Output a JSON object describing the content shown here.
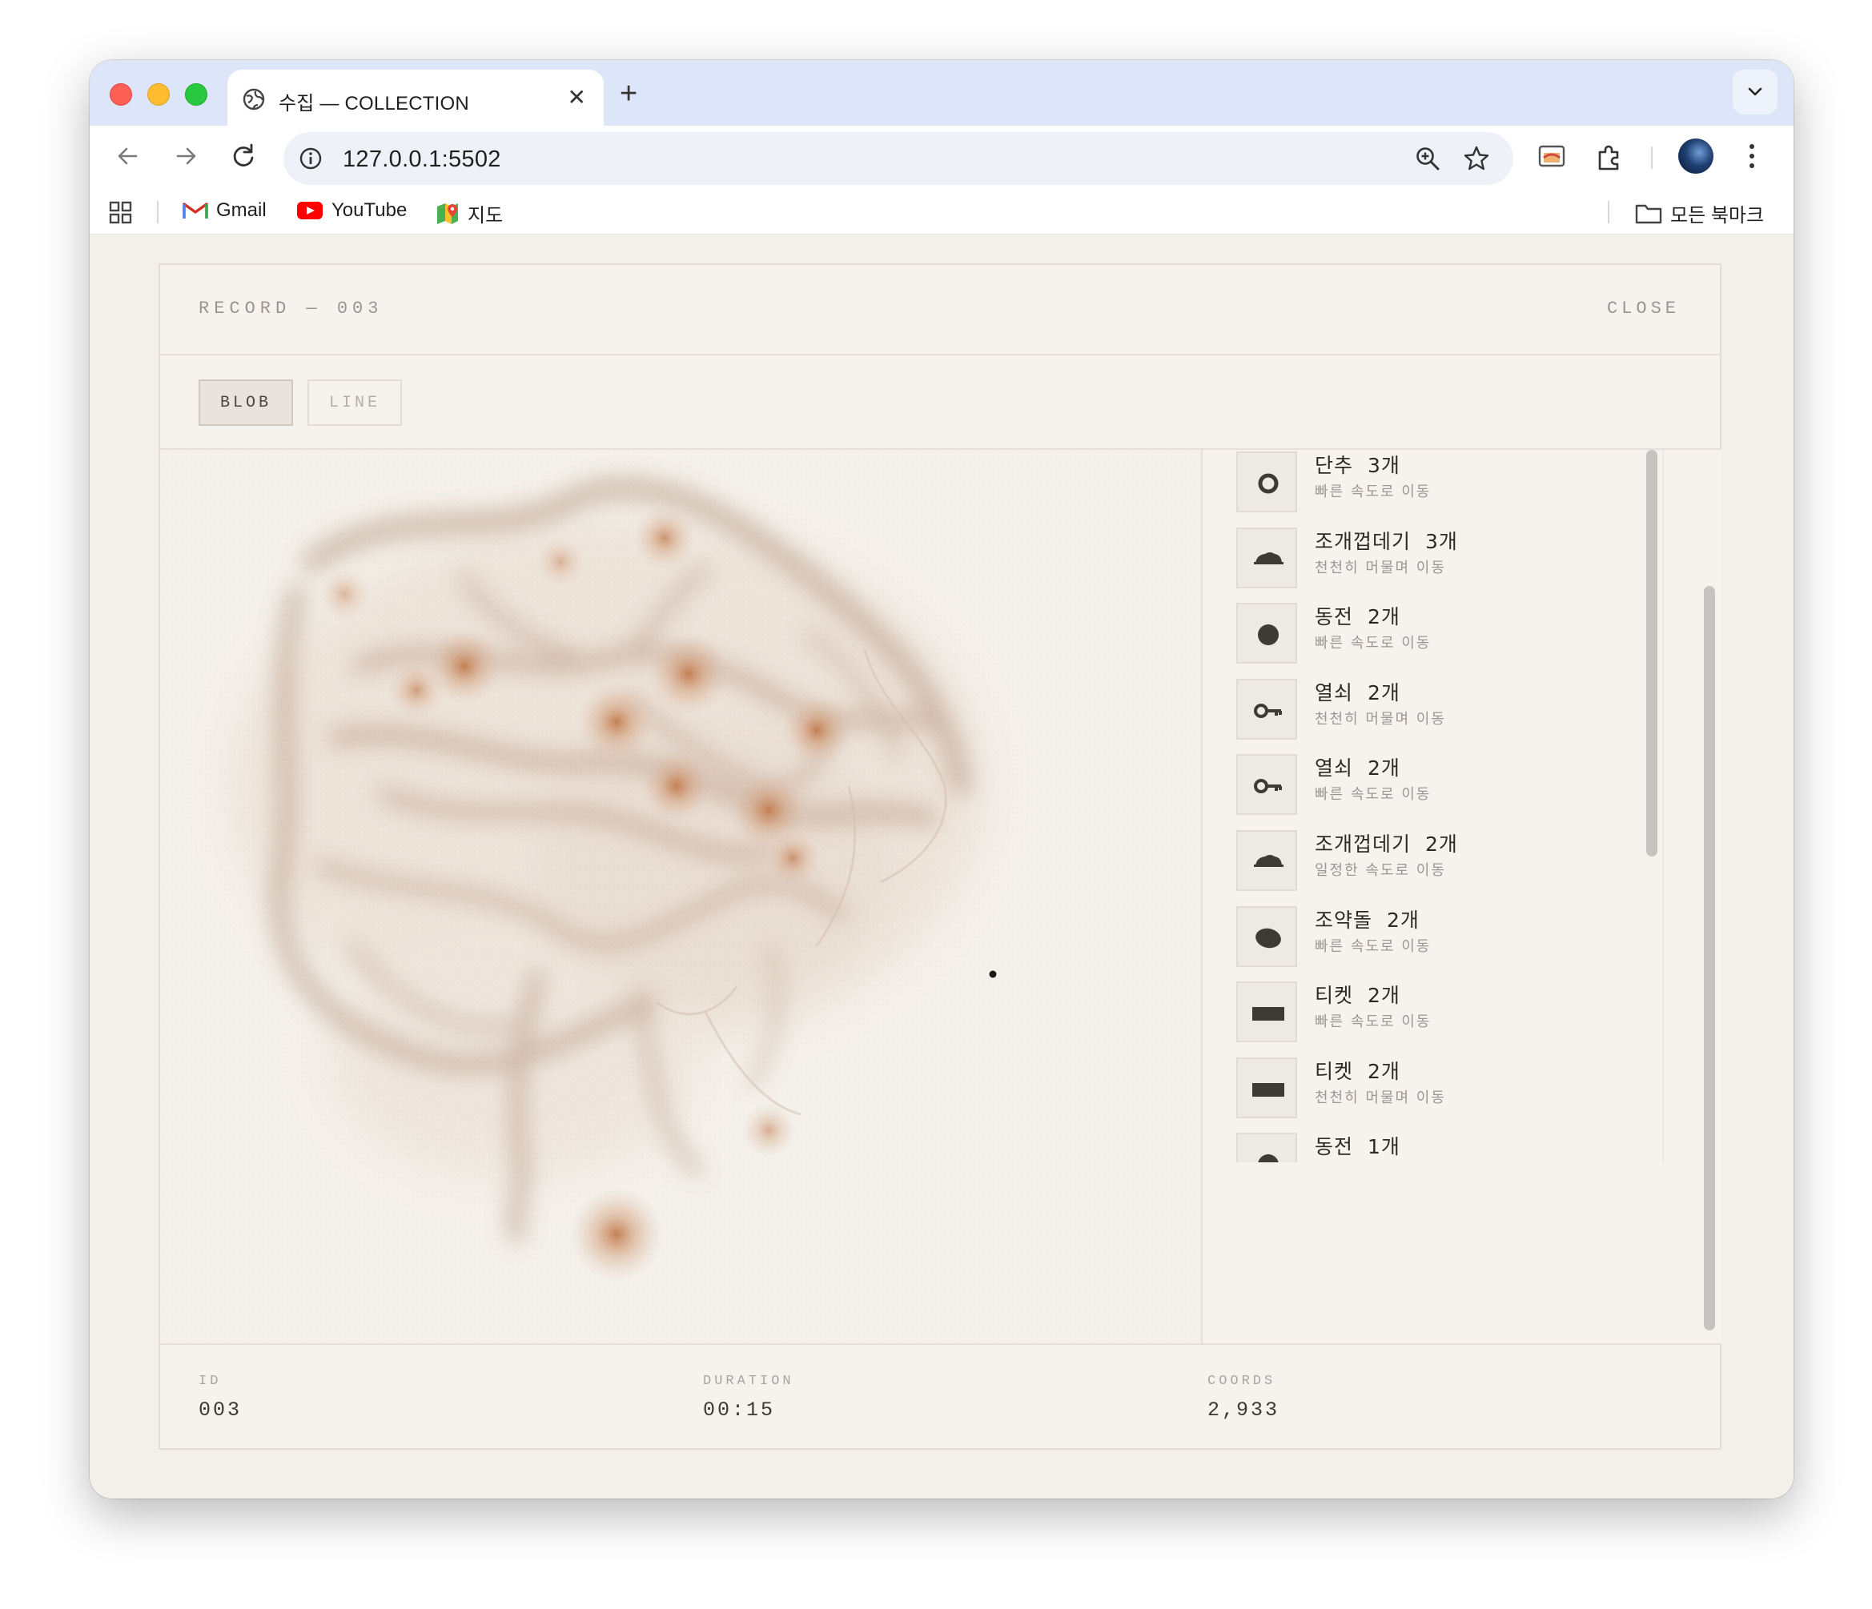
{
  "browser": {
    "tab_title": "수집 — COLLECTION",
    "tab_close": "✕",
    "new_tab": "+",
    "url": "127.0.0.1:5502",
    "bookmarks": {
      "gmail": "Gmail",
      "youtube": "YouTube",
      "maps": "지도",
      "all_bookmarks": "모든 북마크"
    }
  },
  "modal": {
    "record_label": "RECORD — 003",
    "close_label": "CLOSE",
    "modes": {
      "blob": "BLOB",
      "line": "LINE",
      "active": "blob"
    },
    "items": [
      {
        "name": "단추",
        "count": "3개",
        "desc": "빠른 속도로 이동",
        "shape": "ring"
      },
      {
        "name": "조개껍데기",
        "count": "3개",
        "desc": "천천히 머물며 이동",
        "shape": "shell"
      },
      {
        "name": "동전",
        "count": "2개",
        "desc": "빠른 속도로 이동",
        "shape": "circle"
      },
      {
        "name": "열쇠",
        "count": "2개",
        "desc": "천천히 머물며 이동",
        "shape": "key"
      },
      {
        "name": "열쇠",
        "count": "2개",
        "desc": "빠른 속도로 이동",
        "shape": "key"
      },
      {
        "name": "조개껍데기",
        "count": "2개",
        "desc": "일정한 속도로 이동",
        "shape": "shell"
      },
      {
        "name": "조약돌",
        "count": "2개",
        "desc": "빠른 속도로 이동",
        "shape": "pebble"
      },
      {
        "name": "티켓",
        "count": "2개",
        "desc": "빠른 속도로 이동",
        "shape": "ticket"
      },
      {
        "name": "티켓",
        "count": "2개",
        "desc": "천천히 머물며 이동",
        "shape": "ticket"
      },
      {
        "name": "동전",
        "count": "1개",
        "desc": "",
        "shape": "circle"
      }
    ],
    "footer": {
      "id_label": "ID",
      "id_value": "003",
      "duration_label": "DURATION",
      "duration_value": "00:15",
      "coords_label": "COORDS",
      "coords_value": "2,933"
    }
  },
  "colors": {
    "blob": "#b4764a",
    "blob_core": "#c0703a",
    "trail": "#b89a85",
    "page_bg": "#f3efe9"
  }
}
